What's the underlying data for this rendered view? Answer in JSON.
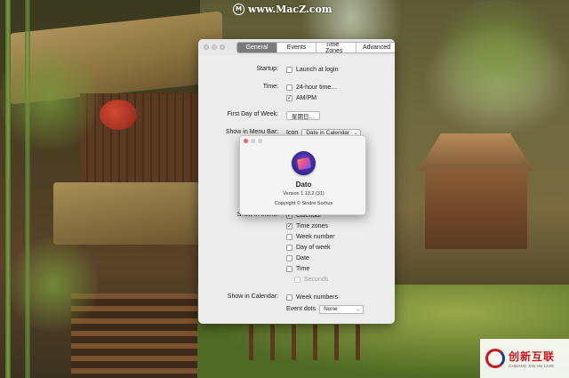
{
  "watermark_top": {
    "logo": "M",
    "text": "www.MacZ.com"
  },
  "watermark_bottom": {
    "cn": "创新互联",
    "en": "CHUANG XIN HU LIAN"
  },
  "prefs": {
    "tabs": [
      {
        "label": "General",
        "active": true
      },
      {
        "label": "Events",
        "active": false
      },
      {
        "label": "Time Zones",
        "active": false
      },
      {
        "label": "Advanced",
        "active": false
      }
    ],
    "startup": {
      "label": "Startup:",
      "launch_at_login": {
        "label": "Launch at login",
        "checked": false
      }
    },
    "time": {
      "label": "Time:",
      "hour24": {
        "label": "24-hour time…",
        "checked": false
      },
      "ampm": {
        "label": "AM/PM",
        "checked": true
      }
    },
    "first_day": {
      "label": "First Day of Week:",
      "button": "星期日…"
    },
    "menu_bar": {
      "label": "Show in Menu Bar:",
      "icon_label": "Icon",
      "selected": "Date in Calendar"
    },
    "show_in_menu": {
      "label": "Show in Menu:",
      "items": [
        {
          "label": "Calendar",
          "checked": true,
          "disabled": false
        },
        {
          "label": "Time zones",
          "checked": true,
          "disabled": false
        },
        {
          "label": "Week number",
          "checked": false,
          "disabled": false
        },
        {
          "label": "Day of week",
          "checked": false,
          "disabled": false
        },
        {
          "label": "Date",
          "checked": false,
          "disabled": false
        },
        {
          "label": "Time",
          "checked": false,
          "disabled": false
        },
        {
          "label": "Seconds",
          "checked": false,
          "disabled": true
        }
      ]
    },
    "show_in_calendar": {
      "label": "Show in Calendar:",
      "week_numbers": {
        "label": "Week numbers",
        "checked": false
      }
    },
    "event_dots": {
      "label": "Event dots",
      "selected": "None"
    }
  },
  "about": {
    "app_name": "Dato",
    "version": "Version 1.13.2 (31)",
    "copyright": "Copyright © Sindre Sorhus",
    "colors": {
      "close": "#ff5f57",
      "inactive": "#d0d0d0"
    }
  },
  "check_glyph": "✓",
  "chevron_glyph": "⌄"
}
